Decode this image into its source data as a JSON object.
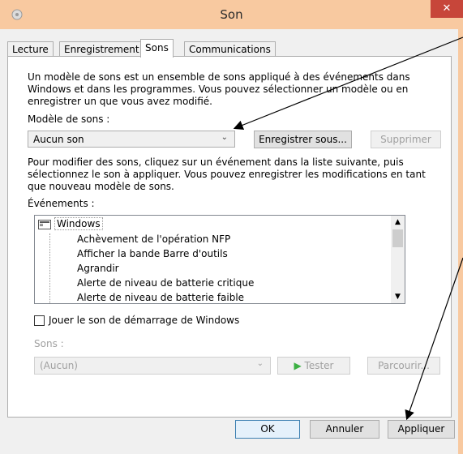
{
  "window": {
    "title": "Son"
  },
  "tabs": [
    {
      "label": "Lecture"
    },
    {
      "label": "Enregistrement"
    },
    {
      "label": "Sons"
    },
    {
      "label": "Communications"
    }
  ],
  "intro_text": [
    "Un modèle de sons est un ensemble de sons appliqué à des événements dans",
    "Windows et dans les programmes. Vous pouvez sélectionner un modèle ou en",
    "enregistrer un que vous avez modifié."
  ],
  "scheme": {
    "label": "Modèle de sons :",
    "value": "Aucun son",
    "save_as_label": "Enregistrer sous...",
    "delete_label": "Supprimer"
  },
  "instruction_text": [
    "Pour modifier des sons, cliquez sur un événement dans la liste suivante, puis",
    "sélectionnez le son à appliquer. Vous pouvez enregistrer les modifications en tant",
    "que nouveau modèle de sons."
  ],
  "events": {
    "label": "Événements :",
    "root": "Windows",
    "items": [
      "Achèvement de l'opération NFP",
      "Afficher la bande Barre d'outils",
      "Agrandir",
      "Alerte de niveau de batterie critique",
      "Alerte de niveau de batterie faible"
    ]
  },
  "startup_checkbox": {
    "label": "Jouer le son de démarrage de Windows",
    "checked": false
  },
  "sounds": {
    "label": "Sons :",
    "value": "(Aucun)",
    "test_label": "Tester",
    "browse_label": "Parcourir..."
  },
  "footer": {
    "ok_label": "OK",
    "cancel_label": "Annuler",
    "apply_label": "Appliquer"
  },
  "colors": {
    "titlebar": "#f8c9a0",
    "close": "#c7463a",
    "play_icon": "#3cb043"
  }
}
